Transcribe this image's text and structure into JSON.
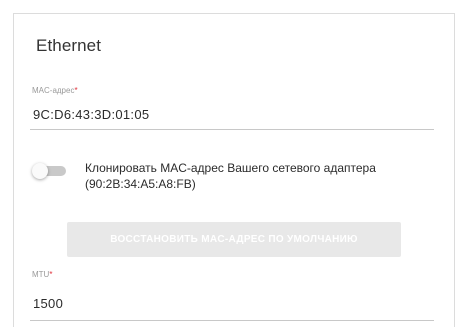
{
  "section": {
    "title": "Ethernet"
  },
  "mac": {
    "label": "MAC-адрес",
    "required_mark": "*",
    "value": "9C:D6:43:3D:01:05"
  },
  "clone": {
    "enabled": false,
    "label": "Клонировать MAC-адрес Вашего сетевого адаптера (90:2B:34:A5:A8:FB)"
  },
  "restore_button": {
    "label": "ВОССТАНОВИТЬ MAC-АДРЕС ПО УМОЛЧАНИЮ",
    "enabled": false
  },
  "mtu": {
    "label": "MTU",
    "required_mark": "*",
    "value": "1500"
  },
  "colors": {
    "required": "#e0303a",
    "button_disabled_bg": "#e8e8e8",
    "toggle_track": "#c9c9c9"
  }
}
